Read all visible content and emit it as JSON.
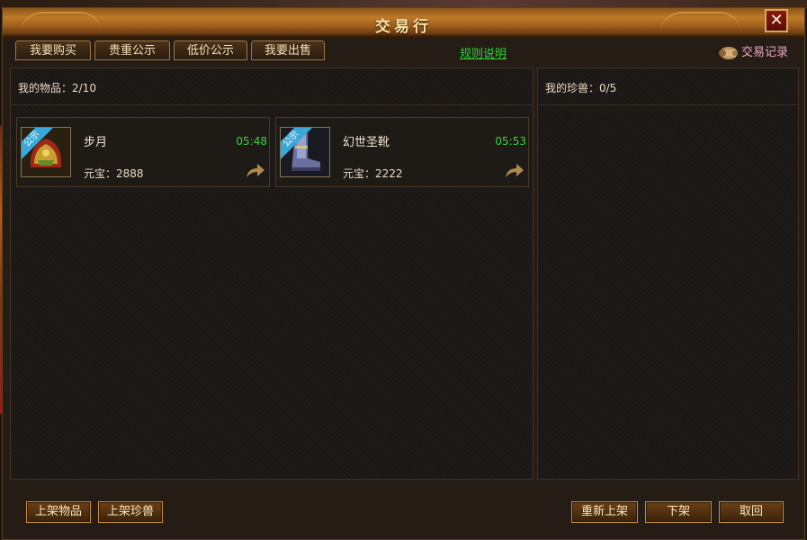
{
  "window": {
    "title": "交易行",
    "close_label": "✕"
  },
  "tabs": [
    {
      "label": "我要购买"
    },
    {
      "label": "贵重公示"
    },
    {
      "label": "低价公示"
    },
    {
      "label": "我要出售"
    }
  ],
  "rules_link": "规则说明",
  "trade_record": "交易记录",
  "items_panel": {
    "label": "我的物品：2/10",
    "items": [
      {
        "name": "步月",
        "time": "05:48",
        "price": "元宝：2888",
        "badge": "公示",
        "icon": "helmet-icon"
      },
      {
        "name": "幻世圣靴",
        "time": "05:53",
        "price": "元宝：2222",
        "badge": "公示",
        "icon": "boots-icon"
      }
    ]
  },
  "pets_panel": {
    "label": "我的珍兽：0/5"
  },
  "bottom_buttons": {
    "list_item": "上架物品",
    "list_pet": "上架珍兽",
    "relist": "重新上架",
    "delist": "下架",
    "cancel": "取回"
  },
  "colors": {
    "accent_green": "#34d63a",
    "record_pink": "#f0a8c8",
    "badge_blue": "#3aa8d8"
  }
}
